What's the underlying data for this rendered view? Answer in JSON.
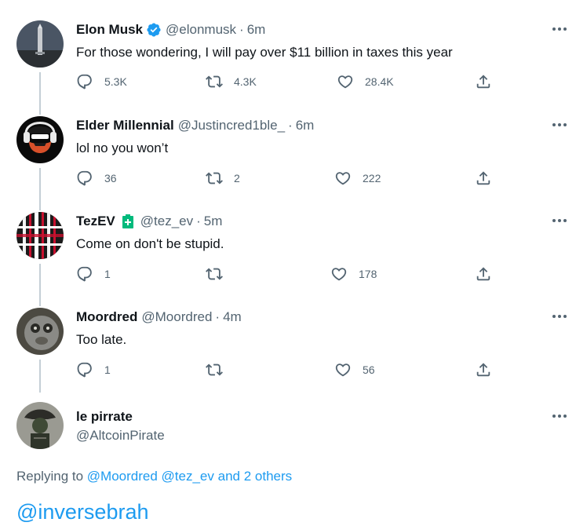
{
  "tweets": [
    {
      "name": "Elon Musk",
      "handle": "@elonmusk",
      "dot": "·",
      "time": "6m",
      "verified": true,
      "text": "For those wondering, I will pay over $11 billion in taxes this year",
      "replies": "5.3K",
      "retweets": "4.3K",
      "likes": "28.4K"
    },
    {
      "name": "Elder Millennial",
      "handle": "@Justincred1ble_",
      "dot": "·",
      "time": "6m",
      "text": "lol no you won’t",
      "replies": "36",
      "retweets": "2",
      "likes": "222"
    },
    {
      "name": "TezEV",
      "badge_icon": "battery-icon",
      "handle": "@tez_ev",
      "dot": "·",
      "time": "5m",
      "text": "Come on don't be stupid.",
      "replies": "1",
      "retweets": "",
      "likes": "178"
    },
    {
      "name": "Moordred",
      "handle": "@Moordred",
      "dot": "·",
      "time": "4m",
      "text": "Too late.",
      "replies": "1",
      "retweets": "",
      "likes": "56"
    }
  ],
  "composer": {
    "name": "le pirrate",
    "handle": "@AltcoinPirate",
    "replying_prefix": "Replying to",
    "replying_to_1": "@Moordred",
    "replying_to_2": "@tez_ev",
    "replying_others": "and 2 others",
    "draft_text": "@inversebrah"
  },
  "colors": {
    "accent": "#1d9bf0",
    "secondary_text": "#536471",
    "thread_line": "#c4cfd6",
    "verified": "#1d9bf0",
    "battery": "#00ba7c"
  }
}
